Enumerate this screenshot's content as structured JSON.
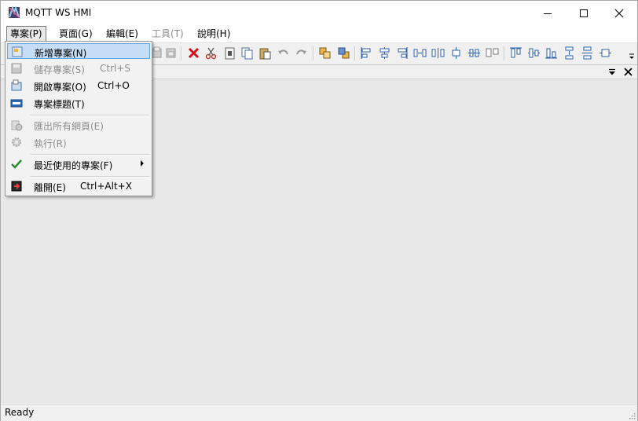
{
  "window": {
    "title": "MQTT WS HMI"
  },
  "menubar": {
    "items": [
      {
        "label": "專案(P)"
      },
      {
        "label": "頁面(G)"
      },
      {
        "label": "編輯(E)"
      },
      {
        "label": "工具(T)"
      },
      {
        "label": "說明(H)"
      }
    ]
  },
  "file_menu": {
    "items": [
      {
        "label": "新增專案(N)",
        "shortcut": ""
      },
      {
        "label": "儲存專案(S)",
        "shortcut": "Ctrl+S"
      },
      {
        "label": "開啟專案(O)",
        "shortcut": "Ctrl+O"
      },
      {
        "label": "專案標題(T)",
        "shortcut": ""
      },
      {
        "label": "匯出所有網頁(E)",
        "shortcut": ""
      },
      {
        "label": "執行(R)",
        "shortcut": ""
      },
      {
        "label": "最近使用的專案(F)",
        "shortcut": ""
      },
      {
        "label": "離開(E)",
        "shortcut": "Ctrl+Alt+X"
      }
    ]
  },
  "status": {
    "text": "Ready"
  },
  "colors": {
    "highlight": "#c5def5",
    "delete_red": "#d0101a",
    "align_blue": "#2a5fa8"
  }
}
